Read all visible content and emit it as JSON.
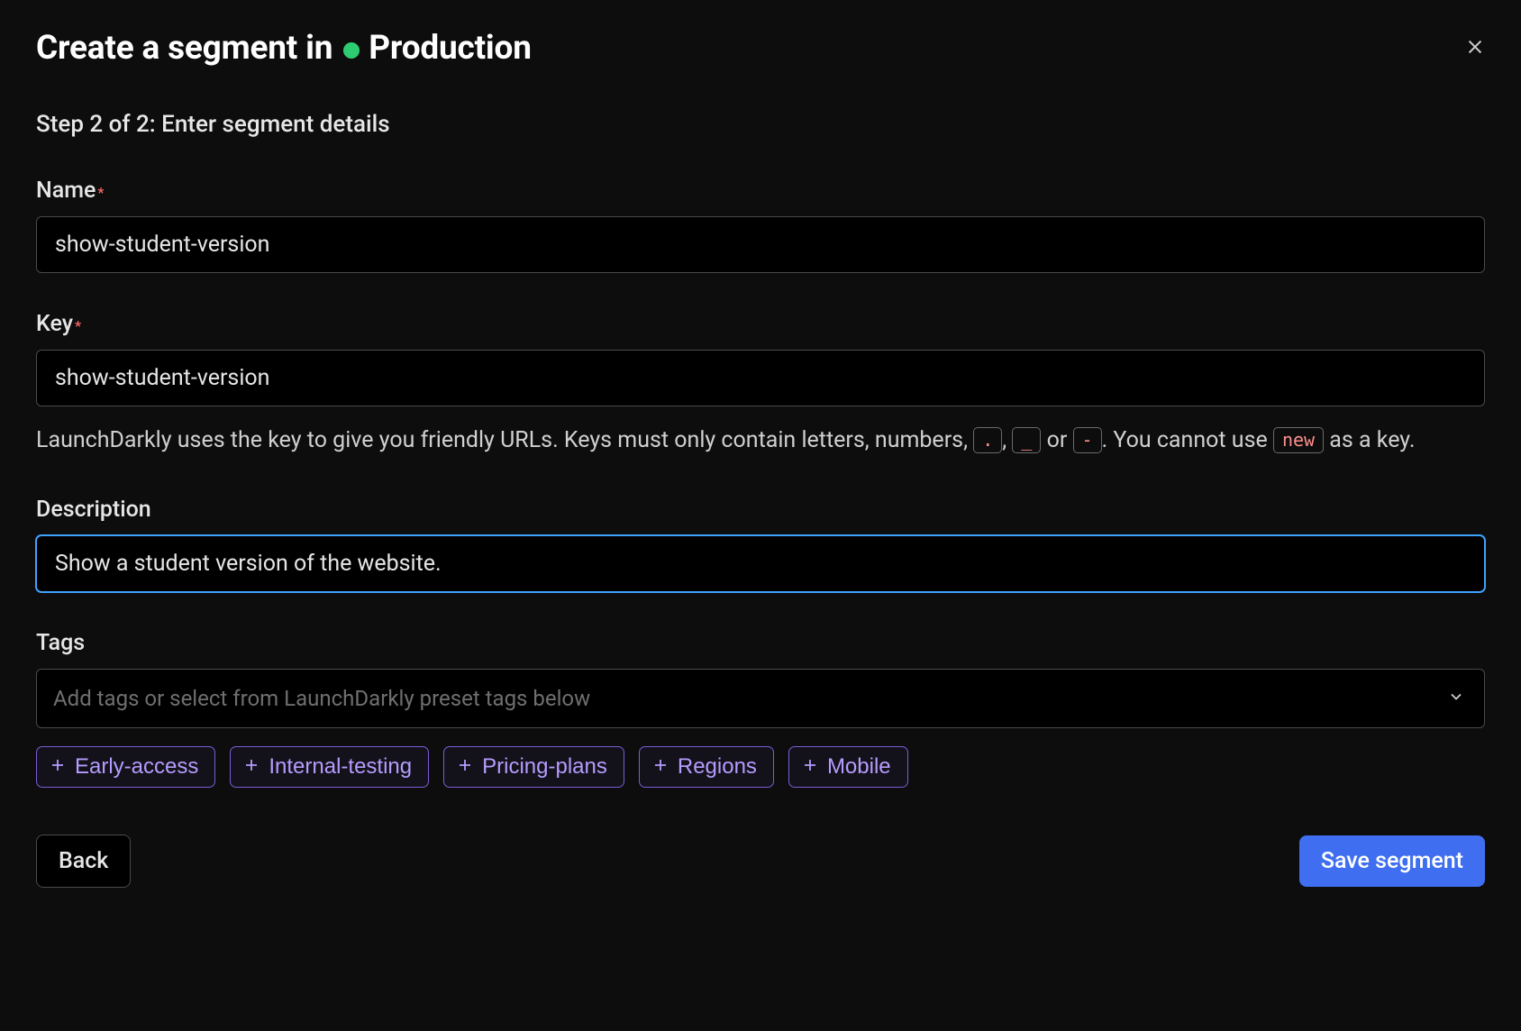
{
  "header": {
    "title_prefix": "Create a segment in",
    "environment": "Production"
  },
  "step": {
    "text": "Step 2 of 2: Enter segment details"
  },
  "fields": {
    "name": {
      "label": "Name",
      "value": "show-student-version"
    },
    "key": {
      "label": "Key",
      "value": "show-student-version",
      "help_prefix": "LaunchDarkly uses the key to give you friendly URLs. Keys must only contain letters, numbers, ",
      "help_tokens": [
        ".",
        "_",
        "-"
      ],
      "help_sep1": ", ",
      "help_sep2": " or ",
      "help_mid": ". You cannot use ",
      "help_reserved": "new",
      "help_suffix": " as a key."
    },
    "description": {
      "label": "Description",
      "value": "Show a student version of the website. "
    },
    "tags": {
      "label": "Tags",
      "placeholder": "Add tags or select from LaunchDarkly preset tags below",
      "presets": [
        "Early-access",
        "Internal-testing",
        "Pricing-plans",
        "Regions",
        "Mobile"
      ]
    }
  },
  "buttons": {
    "back": "Back",
    "save": "Save segment"
  }
}
